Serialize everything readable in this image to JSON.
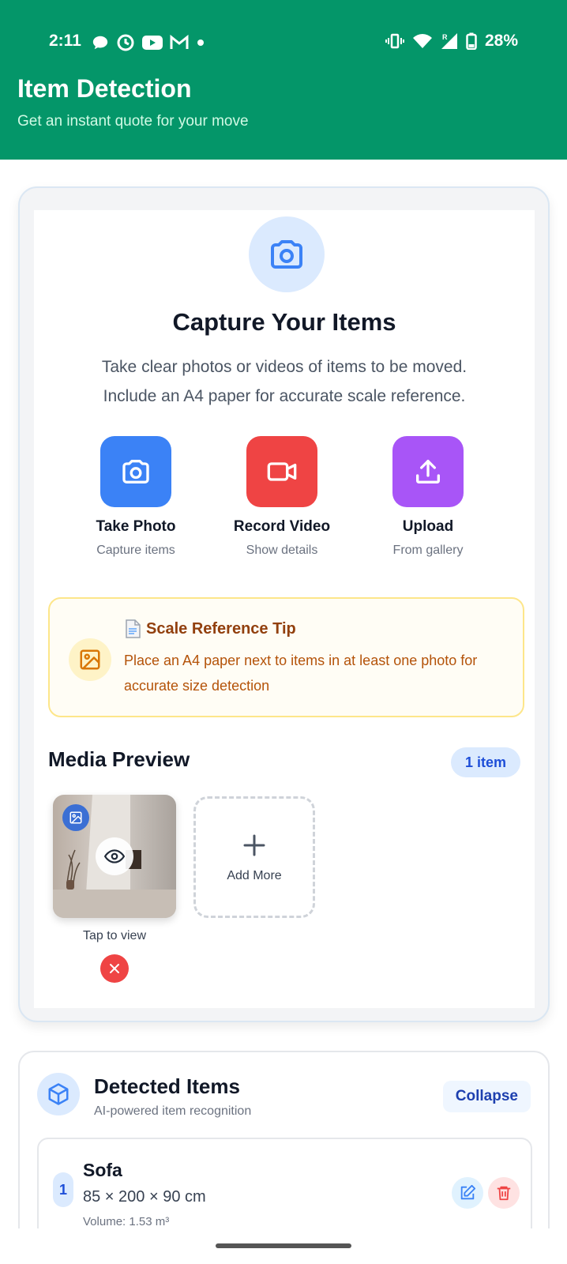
{
  "status_bar": {
    "time": "2:11",
    "battery": "28%"
  },
  "header": {
    "title": "Item Detection",
    "subtitle": "Get an instant quote for your move"
  },
  "capture": {
    "title": "Capture Your Items",
    "desc_line1": "Take clear photos or videos of items to be moved.",
    "desc_line2": "Include an A4 paper for accurate scale reference.",
    "actions": [
      {
        "label": "Take Photo",
        "sub": "Capture items",
        "color": "#3b82f6"
      },
      {
        "label": "Record Video",
        "sub": "Show details",
        "color": "#ef4444"
      },
      {
        "label": "Upload",
        "sub": "From gallery",
        "color": "#a855f7"
      }
    ]
  },
  "tip": {
    "title": "Scale Reference Tip",
    "text": "Place an A4 paper next to items in at least one photo for accurate size detection"
  },
  "media_preview": {
    "title": "Media Preview",
    "badge": "1 item",
    "tap_label": "Tap to view",
    "add_more": "Add More"
  },
  "detected": {
    "title": "Detected Items",
    "subtitle": "AI-powered item recognition",
    "collapse": "Collapse",
    "items": [
      {
        "index": "1",
        "name": "Sofa",
        "dims": "85 × 200 × 90 cm",
        "volume": "Volume: 1.53 m³"
      }
    ]
  },
  "colors": {
    "header_bg": "#049669",
    "primary": "#3b82f6",
    "danger": "#ef4444",
    "accent": "#a855f7"
  }
}
